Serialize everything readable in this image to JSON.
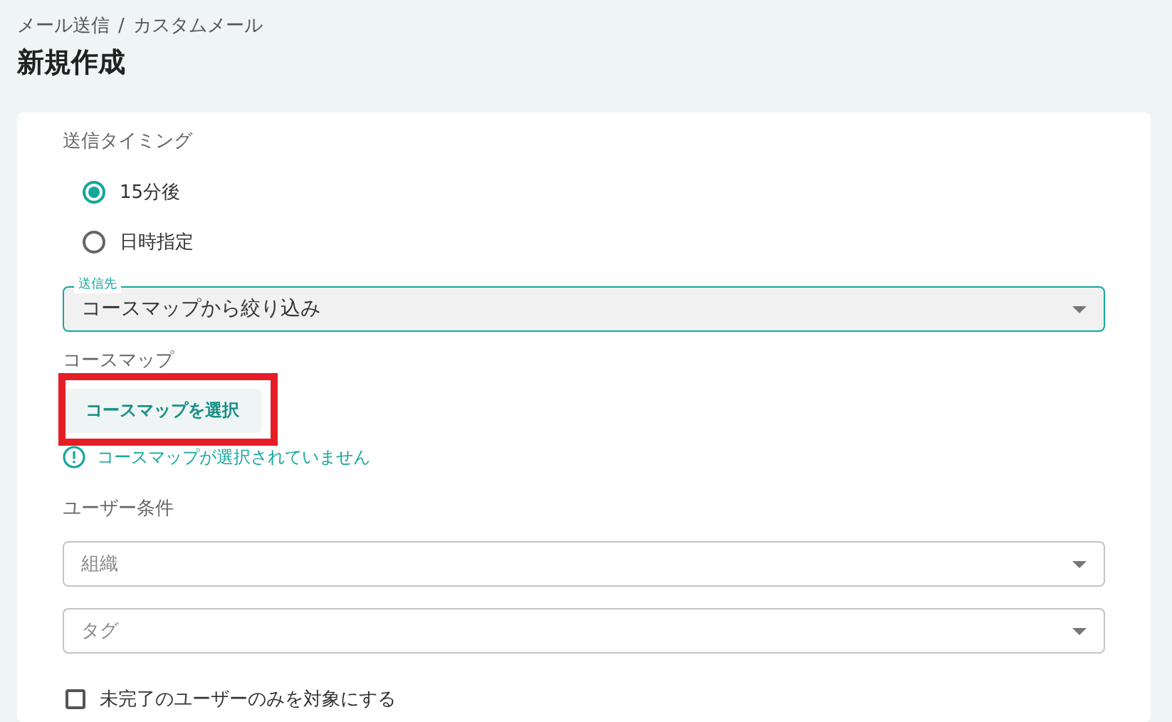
{
  "breadcrumb": [
    {
      "label": "メール送信"
    },
    {
      "label": "/"
    },
    {
      "label": "カスタムメール"
    }
  ],
  "title": "新規作成",
  "timing": {
    "label": "送信タイミング",
    "options": [
      {
        "label": "15分後",
        "selected": true
      },
      {
        "label": "日時指定",
        "selected": false
      }
    ]
  },
  "recipient": {
    "label": "送信先",
    "value": "コースマップから絞り込み",
    "focused": true
  },
  "course_map": {
    "label": "コースマップ",
    "button": "コースマップを選択",
    "highlighted": true,
    "warning": "コースマップが選択されていません"
  },
  "user_conditions": {
    "label": "ユーザー条件",
    "selects": [
      {
        "placeholder": "組織"
      },
      {
        "placeholder": "タグ"
      }
    ]
  },
  "incomplete_only": {
    "label": "未完了のユーザーのみを対象にする",
    "checked": false
  }
}
